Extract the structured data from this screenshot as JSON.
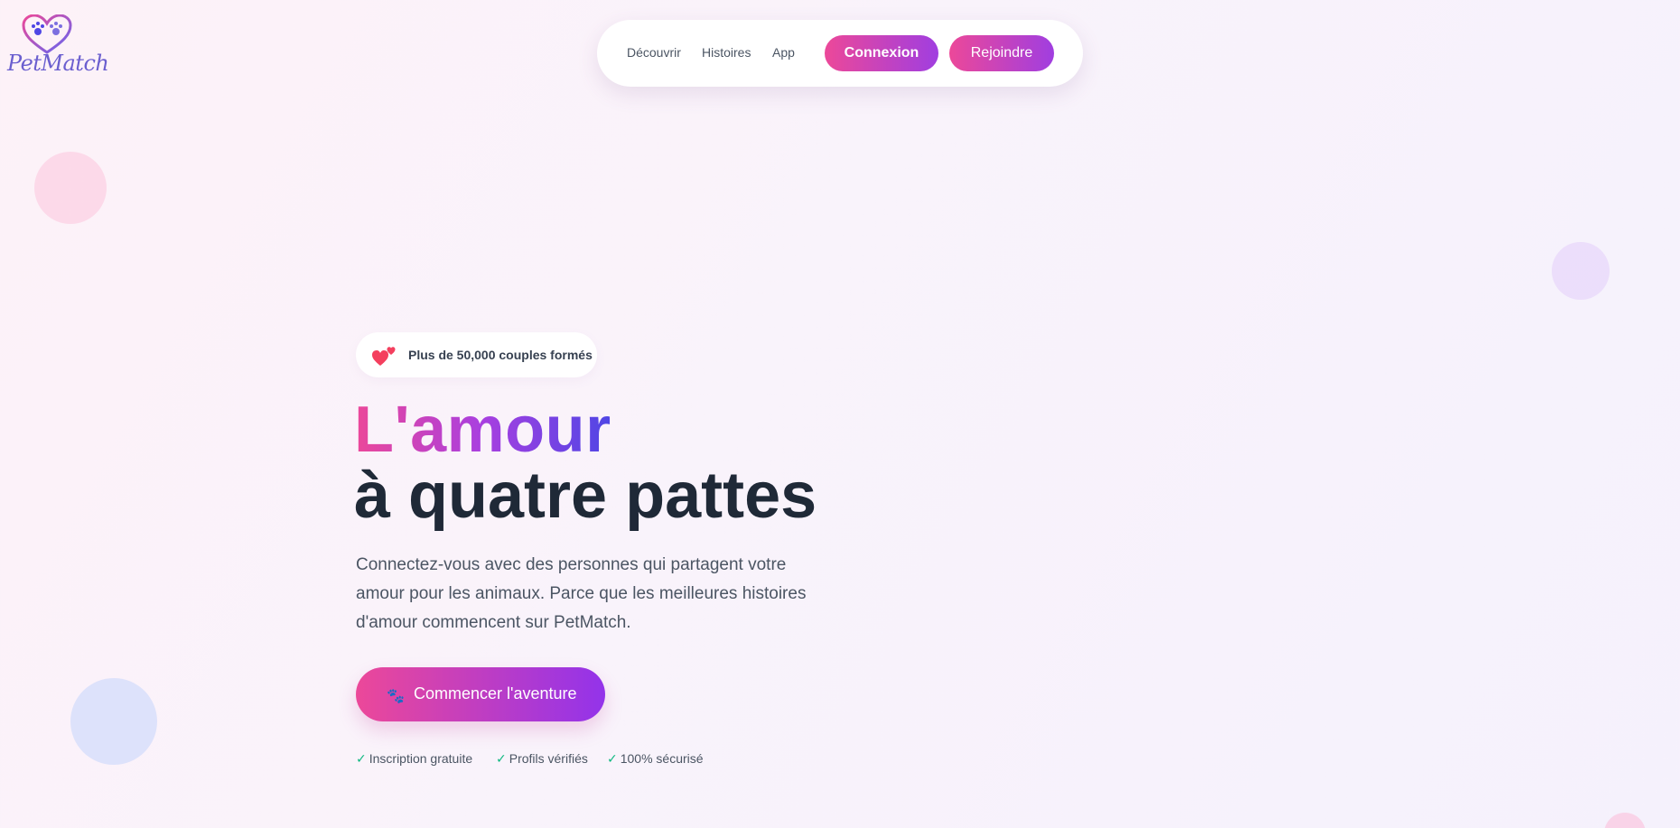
{
  "brand": {
    "name": "PetMatch",
    "icon": "heart-paws-icon"
  },
  "nav": {
    "links": [
      "Découvrir",
      "Histoires",
      "App"
    ],
    "login_label": "Connexion",
    "join_label": "Rejoindre"
  },
  "hero": {
    "badge_icon": "two-hearts-icon",
    "badge_text": "Plus de 50,000 couples formés",
    "title_line1": "L'amour",
    "title_line2": "à quatre pattes",
    "description": "Connectez-vous avec des personnes qui partagent votre amour pour les animaux. Parce que les meilleures histoires d'amour commencent sur PetMatch.",
    "cta_icon": "🐾",
    "cta_label": "Commencer l'aventure",
    "features": [
      "Inscription gratuite",
      "Profils vérifiés",
      "100% sécurisé"
    ],
    "check_glyph": "✓"
  },
  "colors": {
    "accent_pink": "#ec4899",
    "accent_purple": "#9333ea",
    "accent_indigo": "#4f46e5",
    "check_green": "#10b981"
  }
}
